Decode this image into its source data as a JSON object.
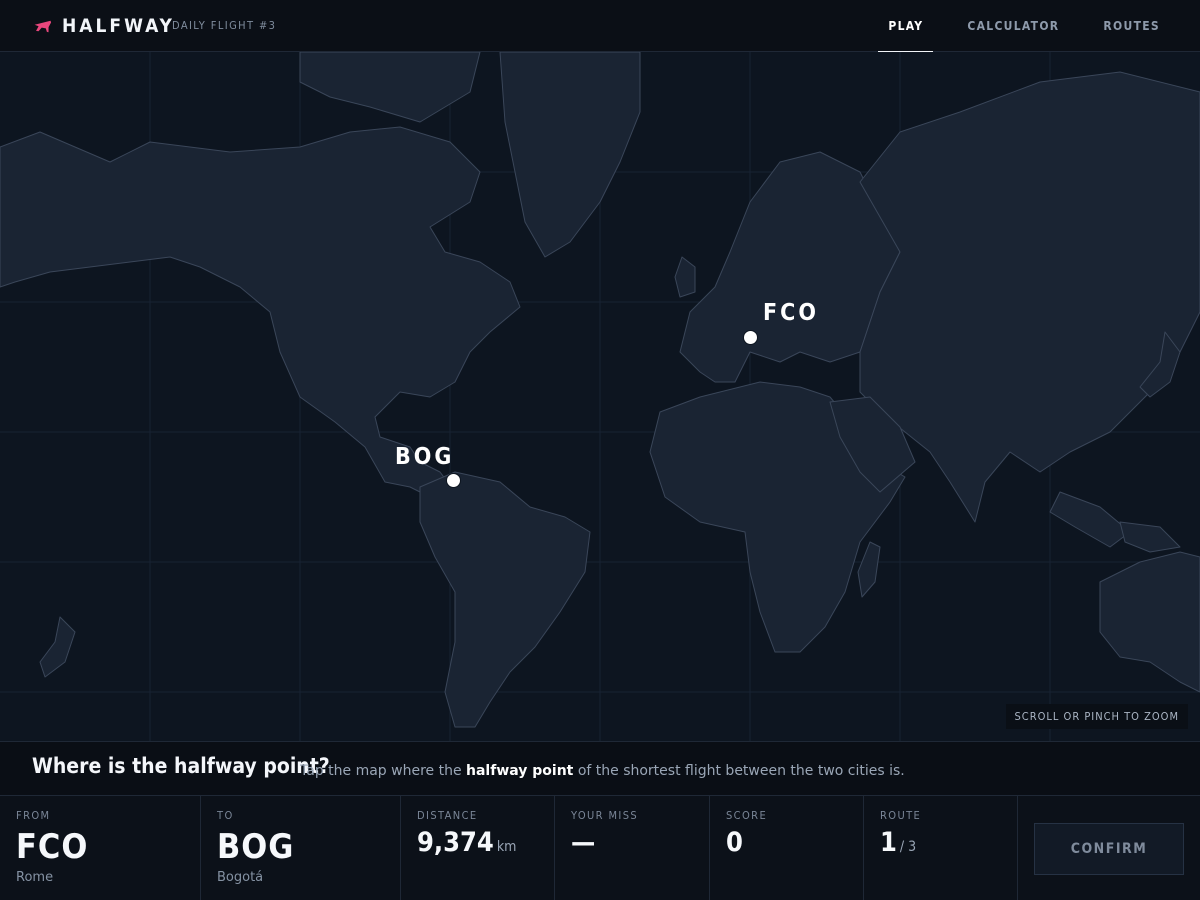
{
  "app": {
    "name": "HALFWAY",
    "flight_tag": "DAILY FLIGHT #3",
    "accent_color": "#e8467c",
    "logo_icon": "airplane-icon"
  },
  "nav": {
    "items": [
      {
        "label": "PLAY",
        "active": true
      },
      {
        "label": "CALCULATOR",
        "active": false
      },
      {
        "label": "ROUTES",
        "active": false
      }
    ]
  },
  "map": {
    "zoom_hint": "SCROLL OR PINCH TO ZOOM",
    "markers": [
      {
        "code": "FCO"
      },
      {
        "code": "BOG"
      }
    ]
  },
  "prompt": {
    "title": "Where is the halfway point?",
    "text_before": "Tap the map where the ",
    "text_bold": "halfway point",
    "text_after": " of the shortest flight between the two cities is."
  },
  "stats": {
    "from": {
      "label": "FROM",
      "code": "FCO",
      "city": "Rome"
    },
    "to": {
      "label": "TO",
      "code": "BOG",
      "city": "Bogotá"
    },
    "distance": {
      "label": "DISTANCE",
      "value": "9,374",
      "unit": "km"
    },
    "miss": {
      "label": "YOUR MISS",
      "value": "—"
    },
    "score": {
      "label": "SCORE",
      "value": "0"
    },
    "route": {
      "label": "ROUTE",
      "current": "1",
      "total": "/ 3"
    },
    "confirm_label": "CONFIRM"
  }
}
